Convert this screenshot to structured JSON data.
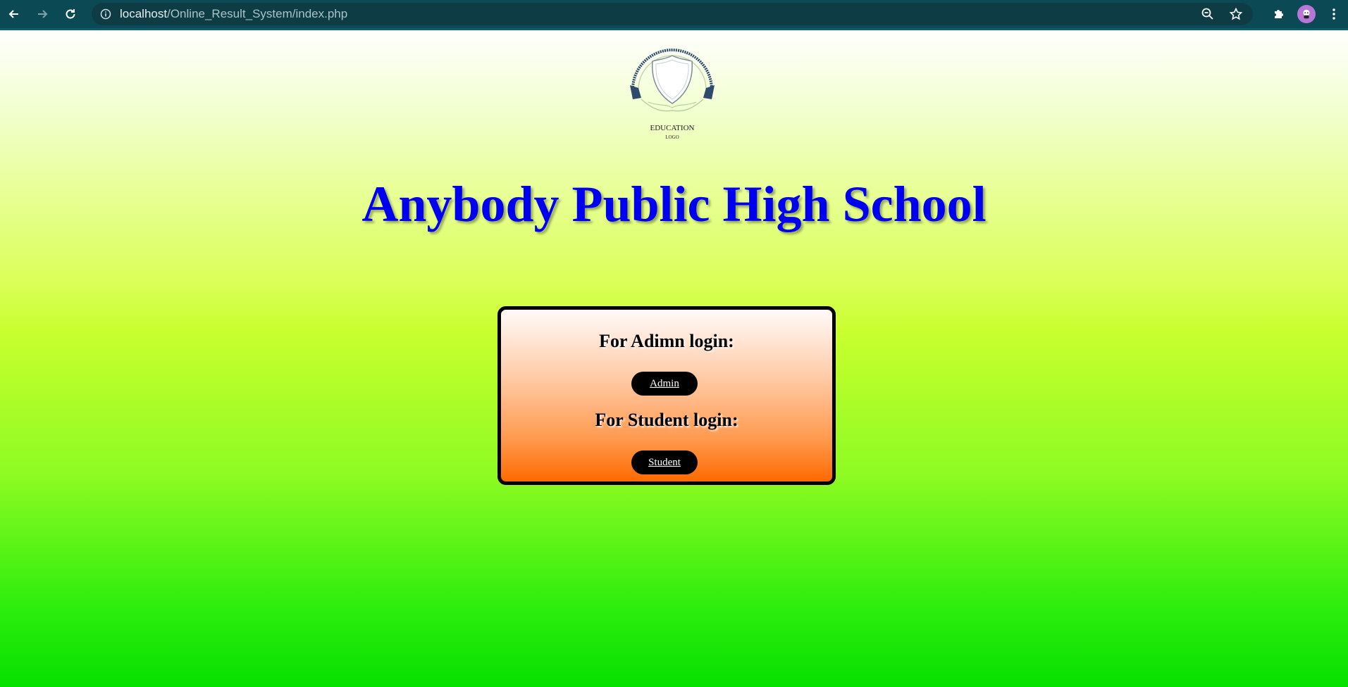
{
  "browser": {
    "url_host": "localhost",
    "url_path": "/Online_Result_System/index.php"
  },
  "logo": {
    "line1": "EDUCATION",
    "line2": "LOGO"
  },
  "page": {
    "title": "Anybody Public High School"
  },
  "login": {
    "admin_heading": "For Adimn login:",
    "admin_button": "Admin",
    "student_heading": "For Student login:",
    "student_button": "Student"
  },
  "colors": {
    "title": "#0000f0",
    "chrome_bg": "#0b4a55",
    "box_border": "#000000",
    "button_bg": "#000000"
  }
}
